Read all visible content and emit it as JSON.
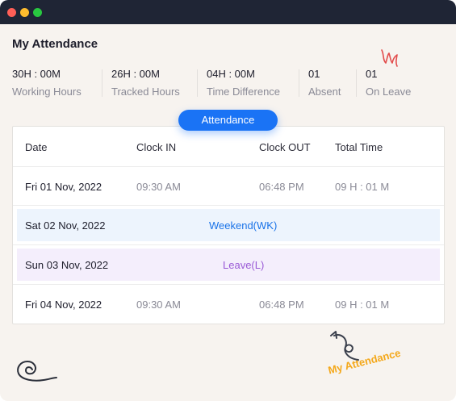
{
  "window": {
    "controls": [
      "close",
      "minimize",
      "maximize"
    ]
  },
  "page": {
    "title": "My Attendance"
  },
  "stats": [
    {
      "value": "30H : 00M",
      "label": "Working Hours"
    },
    {
      "value": "26H : 00M",
      "label": "Tracked Hours"
    },
    {
      "value": "04H : 00M",
      "label": "Time Difference"
    },
    {
      "value": "01",
      "label": "Absent"
    },
    {
      "value": "01",
      "label": "On Leave"
    }
  ],
  "tab": {
    "label": "Attendance"
  },
  "table": {
    "headers": [
      "Date",
      "Clock IN",
      "Clock OUT",
      "Total Time"
    ],
    "rows": [
      {
        "date": "Fri 01 Nov, 2022",
        "clock_in": "09:30 AM",
        "clock_out": "06:48 PM",
        "total": "09 H : 01 M"
      },
      {
        "date": "Sat 02 Nov, 2022",
        "status": "Weekend(WK)"
      },
      {
        "date": "Sun 03 Nov, 2022",
        "status": "Leave(L)"
      },
      {
        "date": "Fri 04 Nov, 2022",
        "clock_in": "09:30 AM",
        "clock_out": "06:48 PM",
        "total": "09 H : 01 M"
      }
    ]
  },
  "footer": {
    "note": "My Attendance"
  },
  "colors": {
    "accent": "#1a73f5",
    "weekend": "#1a73e8",
    "leave": "#9a5ad6",
    "note": "#f4a81b",
    "titlebar": "#1f2535"
  },
  "icons": [
    "scribble-icon",
    "spiral-icon",
    "curved-arrow-icon"
  ]
}
